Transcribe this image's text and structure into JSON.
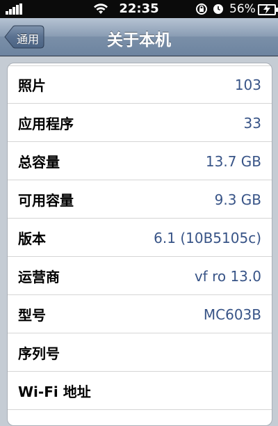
{
  "status": {
    "time": "22:35",
    "battery": "56%"
  },
  "nav": {
    "back_label": "通用",
    "title": "关于本机"
  },
  "rows": [
    {
      "label": "照片",
      "value": "103"
    },
    {
      "label": "应用程序",
      "value": "33"
    },
    {
      "label": "总容量",
      "value": "13.7 GB"
    },
    {
      "label": "可用容量",
      "value": "9.3 GB"
    },
    {
      "label": "版本",
      "value": "6.1 (10B5105c)"
    },
    {
      "label": "运营商",
      "value": "vf ro 13.0"
    },
    {
      "label": "型号",
      "value": "MC603B"
    },
    {
      "label": "序列号",
      "value": ""
    },
    {
      "label": "Wi-Fi 地址",
      "value": ""
    }
  ],
  "colors": {
    "value_text": "#385487",
    "background": "#c5ccd4"
  },
  "icons": [
    "signal-icon",
    "wifi-icon",
    "rotation-lock-icon",
    "alarm-icon",
    "battery-icon",
    "charging-icon"
  ]
}
